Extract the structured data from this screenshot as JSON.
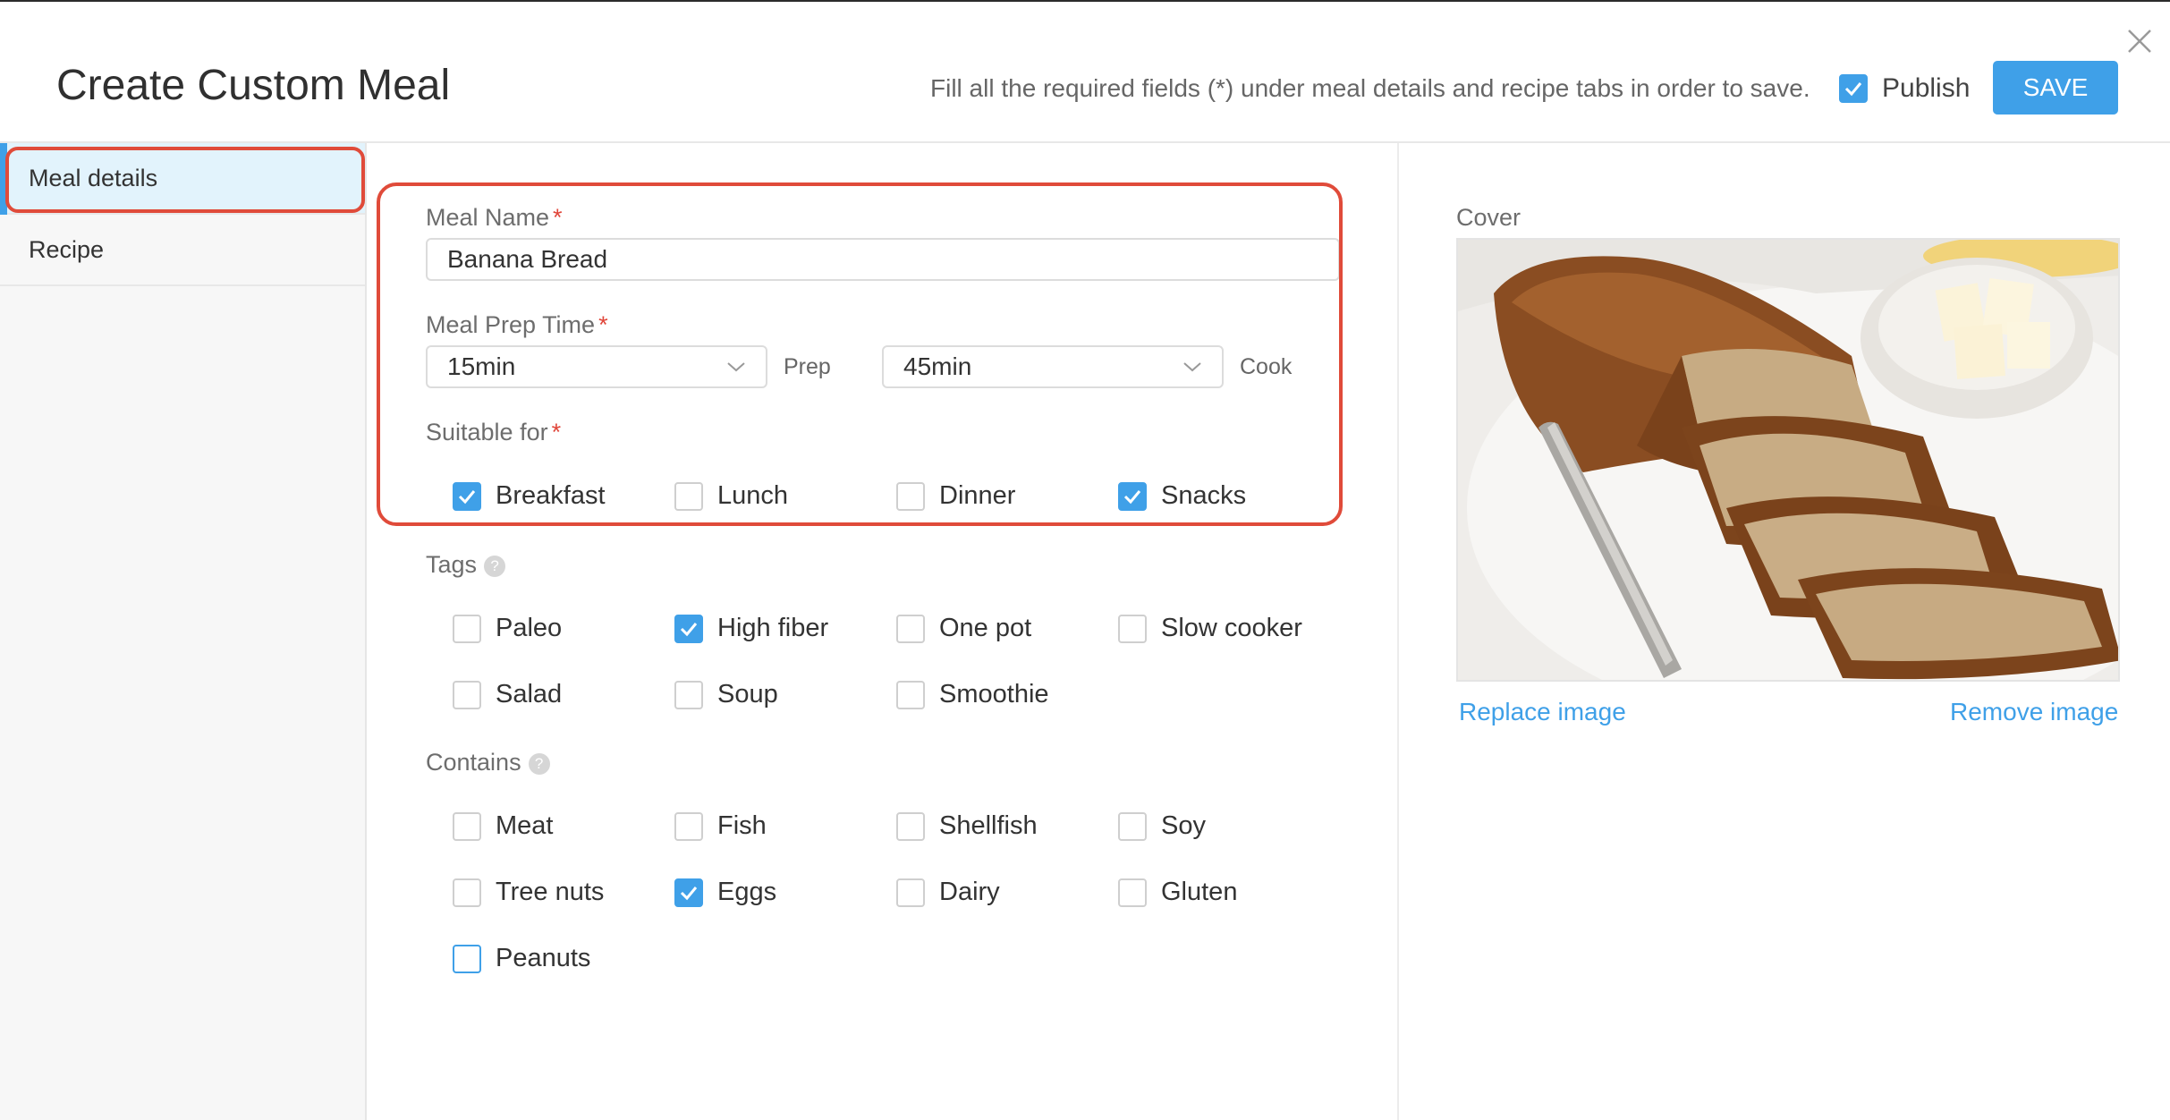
{
  "header": {
    "title": "Create Custom Meal",
    "hint": "Fill all the required fields (*) under meal details and recipe tabs in order to save.",
    "publish_label": "Publish",
    "publish_checked": true,
    "save_label": "SAVE"
  },
  "sidebar": {
    "items": [
      {
        "label": "Meal details",
        "active": true
      },
      {
        "label": "Recipe",
        "active": false
      }
    ]
  },
  "form": {
    "meal_name": {
      "label": "Meal Name",
      "required": "*",
      "value": "Banana Bread"
    },
    "prep_time": {
      "label": "Meal Prep Time",
      "required": "*",
      "prep_value": "15min",
      "prep_unit": "Prep",
      "cook_value": "45min",
      "cook_unit": "Cook"
    },
    "suitable_for": {
      "label": "Suitable for",
      "required": "*",
      "options": [
        {
          "label": "Breakfast",
          "checked": true
        },
        {
          "label": "Lunch",
          "checked": false
        },
        {
          "label": "Dinner",
          "checked": false
        },
        {
          "label": "Snacks",
          "checked": true
        }
      ]
    },
    "tags": {
      "label": "Tags",
      "help": "?",
      "options": [
        {
          "label": "Paleo",
          "checked": false
        },
        {
          "label": "High fiber",
          "checked": true
        },
        {
          "label": "One pot",
          "checked": false
        },
        {
          "label": "Slow cooker",
          "checked": false
        },
        {
          "label": "Salad",
          "checked": false
        },
        {
          "label": "Soup",
          "checked": false
        },
        {
          "label": "Smoothie",
          "checked": false
        }
      ]
    },
    "contains": {
      "label": "Contains",
      "help": "?",
      "options": [
        {
          "label": "Meat",
          "checked": false
        },
        {
          "label": "Fish",
          "checked": false
        },
        {
          "label": "Shellfish",
          "checked": false
        },
        {
          "label": "Soy",
          "checked": false
        },
        {
          "label": "Tree nuts",
          "checked": false
        },
        {
          "label": "Eggs",
          "checked": true
        },
        {
          "label": "Dairy",
          "checked": false
        },
        {
          "label": "Gluten",
          "checked": false
        },
        {
          "label": "Peanuts",
          "checked": false
        }
      ]
    }
  },
  "cover": {
    "label": "Cover",
    "replace_label": "Replace image",
    "remove_label": "Remove image"
  },
  "colors": {
    "accent": "#3fa0e8",
    "highlight": "#e04b3a",
    "required": "#e0463a"
  }
}
